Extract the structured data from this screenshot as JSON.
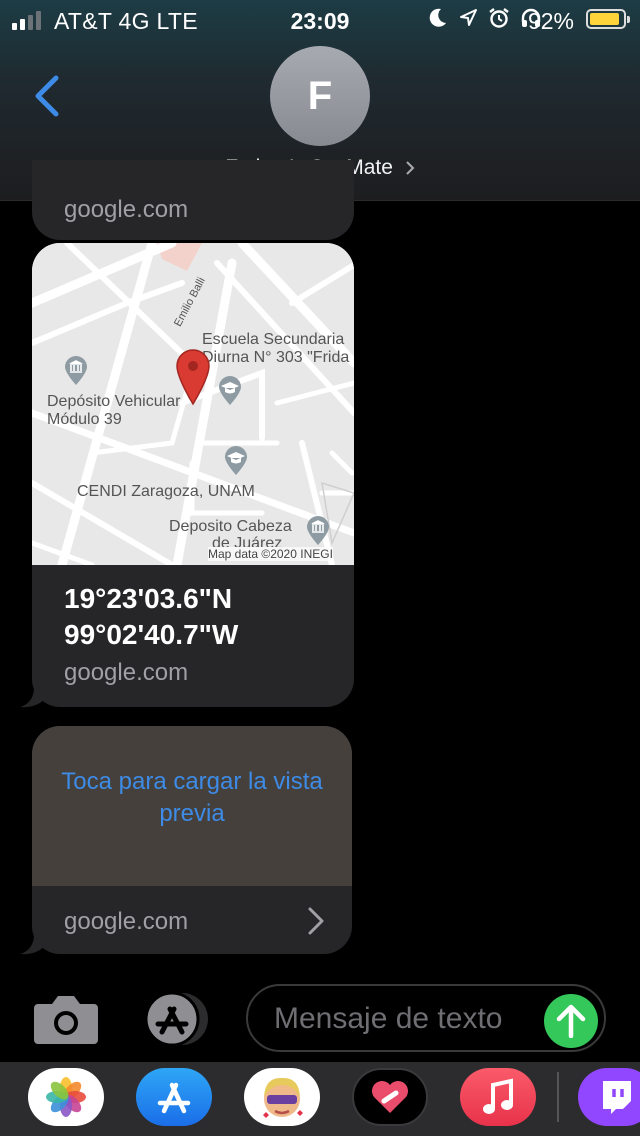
{
  "status_bar": {
    "carrier": "AT&T 4G  LTE",
    "time": "23:09",
    "battery_percent": "92%",
    "battery_level": 0.92,
    "icons": [
      "moon-icon",
      "location-arrow-icon",
      "alarm-icon",
      "headphones-icon"
    ]
  },
  "header": {
    "avatar_initial": "F",
    "contact_name": "Fatima’s SecMate"
  },
  "messages": [
    {
      "type": "link",
      "domain": "google.com"
    },
    {
      "type": "map_link",
      "map": {
        "labels": {
          "street": "Emilio Balli",
          "school_line1": "Escuela Secundaria",
          "school_line2": "Diurna N° 303 \"Frida",
          "deposito_line1": "Depósito Vehicular",
          "deposito_line2": "Módulo 39",
          "cendi": "CENDI Zaragoza, UNAM",
          "cabeza_line1": "Deposito Cabeza",
          "cabeza_line2": "de Juárez",
          "attribution": "Map data ©2020 INEGI"
        }
      },
      "coord_lat": "19°23'03.6\"N",
      "coord_lon": "99°02'40.7\"W",
      "domain": "google.com"
    },
    {
      "type": "link_preview",
      "preview_text": "Toca para cargar la vista previa",
      "domain": "google.com"
    }
  ],
  "input_bar": {
    "placeholder": "Mensaje de texto"
  },
  "app_drawer": {
    "apps": [
      "photos-icon",
      "app-store-icon",
      "memoji-icon",
      "digital-touch-icon",
      "music-icon",
      "twitch-icon"
    ]
  },
  "colors": {
    "accent": "#3d8be6",
    "send": "#34c759",
    "bubble": "#262628",
    "pin": "#d93a32"
  }
}
